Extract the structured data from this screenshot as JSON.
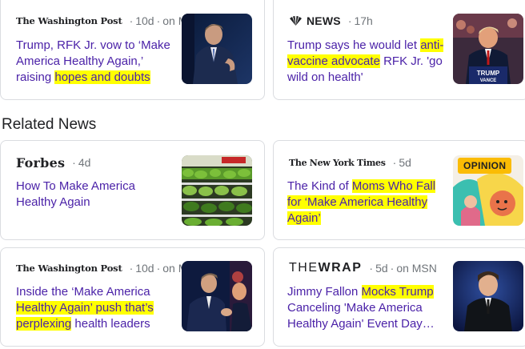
{
  "top_stories": [
    {
      "source": "The Washington Post",
      "age": "10d",
      "via": "on MSN",
      "title_parts": [
        "Trump, RFK Jr. vow to ‘Make America Healthy Again,’ raising ",
        "hopes and doubts",
        ""
      ],
      "thumb_icon": "rfk-speaking-photo"
    },
    {
      "source": "NEWS",
      "age": "17h",
      "title_parts": [
        "Trump says he would let ",
        "anti-vaccine advocate",
        " RFK Jr. 'go wild on health'"
      ],
      "thumb_icon": "trump-rally-photo",
      "thumb_sign_line1": "TRUMP",
      "thumb_sign_line2": "VANCE"
    }
  ],
  "related_heading": "Related News",
  "related": [
    {
      "source": "Forbes",
      "age": "4d",
      "title_parts": [
        "How To Make America Healthy Again",
        "",
        ""
      ],
      "thumb_icon": "grocery-produce-photo"
    },
    {
      "source": "The New York Times",
      "age": "5d",
      "title_parts": [
        "The Kind of ",
        "Moms Who Fall for ‘Make America Healthy Again’",
        ""
      ],
      "badge": "OPINION",
      "thumb_icon": "illustration-moms"
    },
    {
      "source": "The Washington Post",
      "age": "10d",
      "via": "on MSN",
      "title_parts": [
        "Inside the ‘Make America ",
        "Healthy Again’ push that’s perplexing",
        " health leaders"
      ],
      "thumb_icon": "trump-rfk-handshake-photo"
    },
    {
      "source_part1": "THE",
      "source_part2": "WRAP",
      "age": "5d",
      "via": "on MSN",
      "title_parts": [
        "Jimmy Fallon ",
        "Mocks Trump",
        " Canceling 'Make America Healthy Again' Event Day…"
      ],
      "thumb_icon": "jimmy-fallon-photo"
    }
  ],
  "separator": "·"
}
